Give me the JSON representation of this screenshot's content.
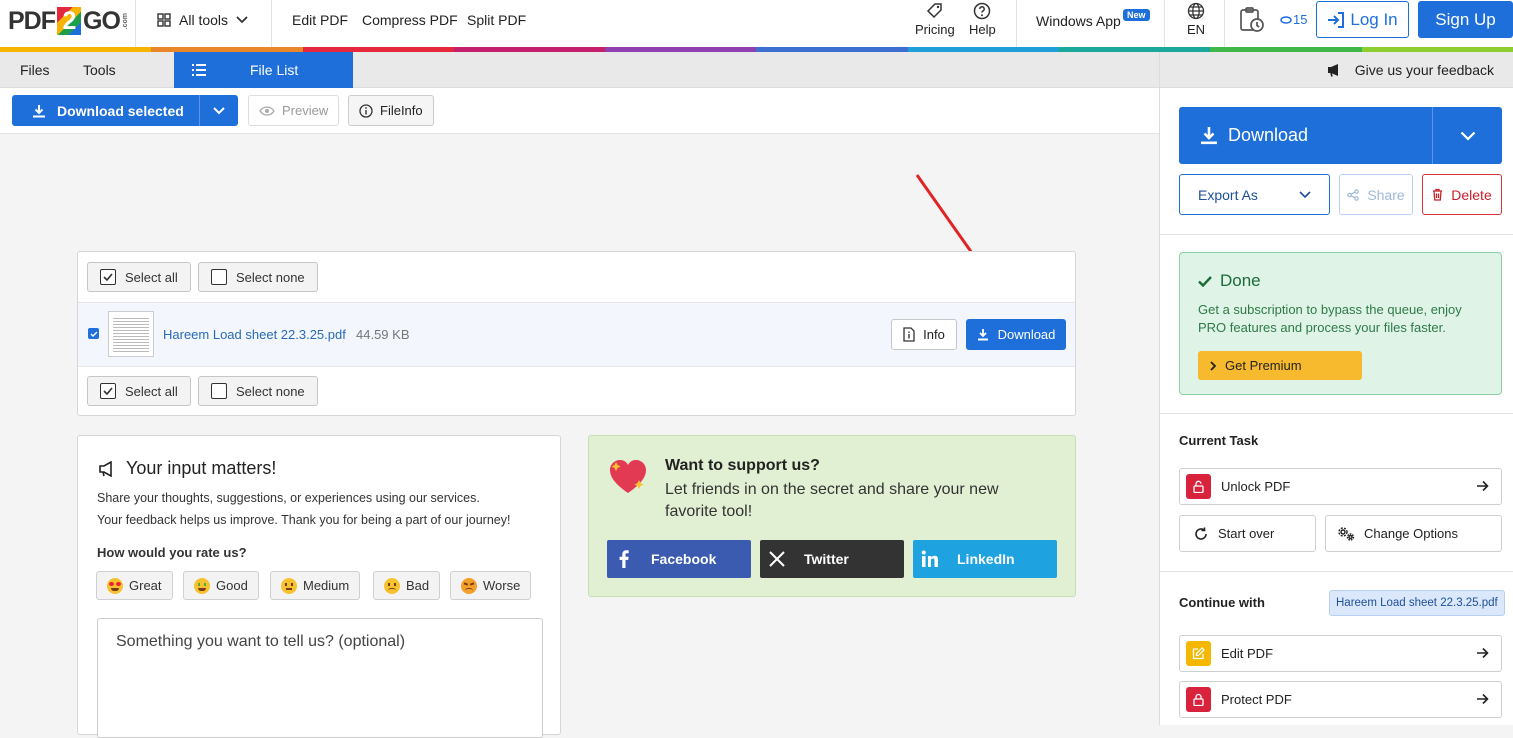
{
  "brand": {
    "logo_left": "PDF",
    "logo_mid": "2",
    "logo_right": "GO",
    "logo_suffix": ".com"
  },
  "nav": {
    "all_tools": "All tools",
    "edit_pdf": "Edit PDF",
    "compress_pdf": "Compress PDF",
    "split_pdf": "Split PDF",
    "pricing": "Pricing",
    "help": "Help",
    "windows_app": "Windows App",
    "new_badge": "New",
    "language": "EN",
    "credits": "15",
    "login": "Log In",
    "signup": "Sign Up"
  },
  "rainbow_colors": [
    "#f5b400",
    "#e8862a",
    "#e5283e",
    "#c4206b",
    "#8e3fb0",
    "#3d6fd0",
    "#1e9fd9",
    "#1aa89a",
    "#41b649",
    "#8ccd2f"
  ],
  "tabs": {
    "files": "Files",
    "tools": "Tools",
    "file_list": "File List"
  },
  "toolbar": {
    "download_selected": "Download selected",
    "preview": "Preview",
    "fileinfo": "FileInfo"
  },
  "filelist": {
    "select_all": "Select all",
    "select_none": "Select none",
    "file_name": "Hareem Load sheet 22.3.25.pdf",
    "file_size": "44.59 KB",
    "info": "Info",
    "download": "Download"
  },
  "feedback_card": {
    "title": "Your input matters!",
    "line1": "Share your thoughts, suggestions, or experiences using our services.",
    "line2": "Your feedback helps us improve. Thank you for being a part of our journey!",
    "rate_q": "How would you rate us?",
    "ratings": [
      "Great",
      "Good",
      "Medium",
      "Bad",
      "Worse"
    ],
    "textarea_placeholder": "Something you want to tell us? (optional)"
  },
  "support_card": {
    "title": "Want to support us?",
    "text": "Let friends in on the secret and share your new favorite tool!",
    "facebook": "Facebook",
    "twitter": "Twitter",
    "linkedin": "LinkedIn"
  },
  "right_panel": {
    "feedback": "Give us your feedback",
    "download": "Download",
    "export_as": "Export As",
    "share": "Share",
    "delete": "Delete",
    "done_title": "Done",
    "done_text": "Get a subscription to bypass the queue, enjoy PRO features and process your files faster.",
    "get_premium": "Get Premium",
    "current_task": "Current Task",
    "unlock_pdf": "Unlock PDF",
    "start_over": "Start over",
    "change_options": "Change Options",
    "continue_with": "Continue with",
    "continue_file": "Hareem Load sheet 22.3.25.pdf",
    "edit_pdf": "Edit PDF",
    "protect_pdf": "Protect PDF"
  }
}
